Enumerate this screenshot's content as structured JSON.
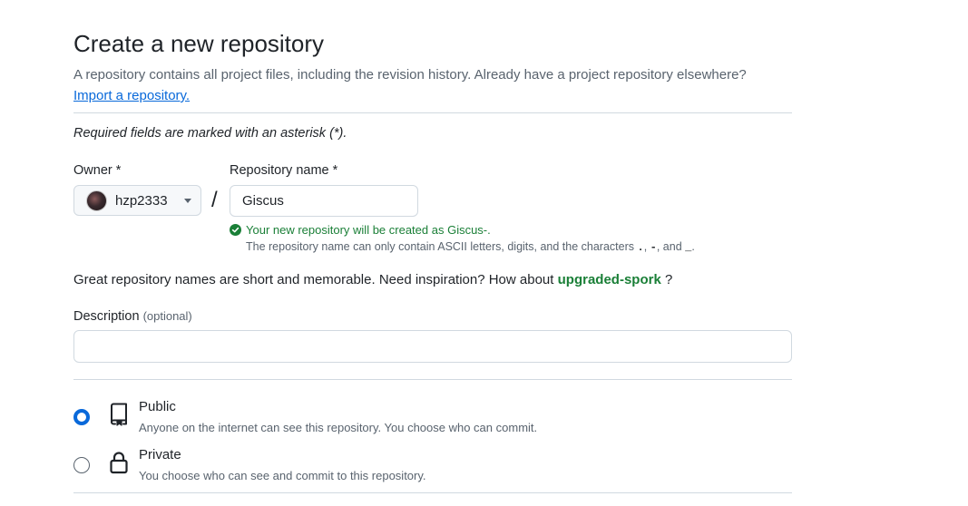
{
  "header": {
    "title": "Create a new repository",
    "intro": "A repository contains all project files, including the revision history. Already have a project repository elsewhere?",
    "import_link": "Import a repository."
  },
  "form": {
    "required_note": "Required fields are marked with an asterisk (*).",
    "owner_label": "Owner *",
    "owner_value": "hzp2333",
    "separator": "/",
    "repo_name_label": "Repository name *",
    "repo_name_value": "Giscus",
    "valid_message": "Your new repository will be created as Giscus-.",
    "hint_prefix": "The repository name can only contain ASCII letters, digits, and the characters",
    "hint_chars_1": ".",
    "hint_sep_1": ",",
    "hint_chars_2": "-",
    "hint_sep_2": ", and",
    "hint_chars_3": "_",
    "hint_suffix": ".",
    "inspiration_text": "Great repository names are short and memorable. Need inspiration? How about",
    "inspiration_suggestion": "upgraded-spork",
    "inspiration_end": "?",
    "description_label": "Description",
    "description_optional": "(optional)",
    "description_value": ""
  },
  "visibility": {
    "public": {
      "title": "Public",
      "desc": "Anyone on the internet can see this repository. You choose who can commit.",
      "selected": true
    },
    "private": {
      "title": "Private",
      "desc": "You choose who can see and commit to this repository.",
      "selected": false
    }
  },
  "colors": {
    "accent": "#0969da",
    "success": "#1a7f37",
    "muted": "#59636e",
    "border": "#d1d9e0"
  },
  "icons": {
    "valid": "check-circle-fill-icon",
    "owner_dropdown": "triangle-down-icon",
    "public": "repo-icon",
    "private": "lock-icon"
  }
}
